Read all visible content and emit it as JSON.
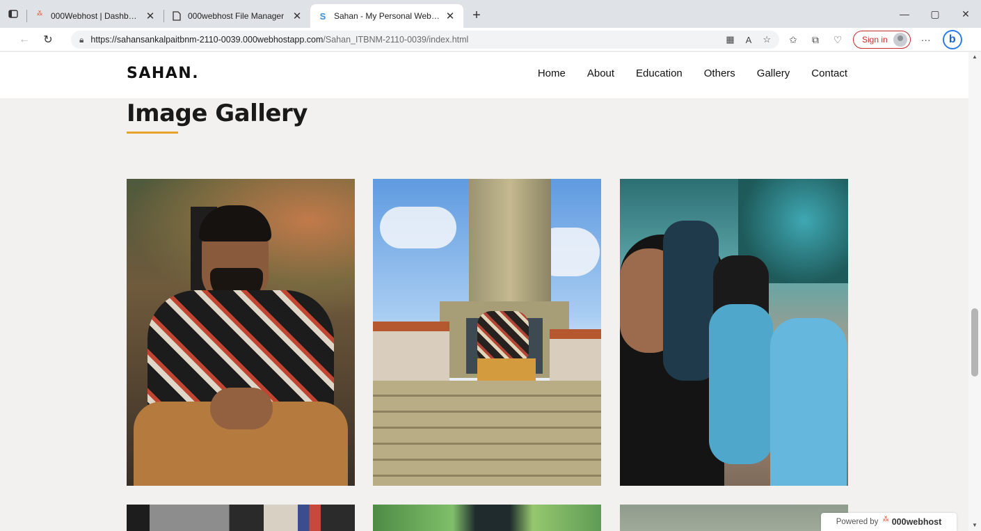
{
  "browser": {
    "tabs": [
      {
        "label": "000Webhost | Dashboard",
        "icon": "webhost-swirl-icon",
        "active": false
      },
      {
        "label": "000webhost File Manager",
        "icon": "file-icon",
        "active": false
      },
      {
        "label": "Sahan - My Personal Web Page",
        "icon": "s-logo-icon",
        "active": true
      }
    ],
    "new_tab_glyph": "+",
    "address": {
      "url_host": "https://sahansankalpaitbnm-2110-0039.000webhostapp.com",
      "url_path": "/Sahan_ITBNM-2110-0039/index.html"
    },
    "sign_in_label": "Sign in",
    "more_glyph": "···"
  },
  "site": {
    "logo": "SAHAN.",
    "nav": [
      "Home",
      "About",
      "Education",
      "Others",
      "Gallery",
      "Contact"
    ],
    "gallery_title": "Image Gallery",
    "accent_color": "#e8a22a"
  },
  "footer_badge": {
    "prefix": "Powered by",
    "brand": "000webhost"
  }
}
